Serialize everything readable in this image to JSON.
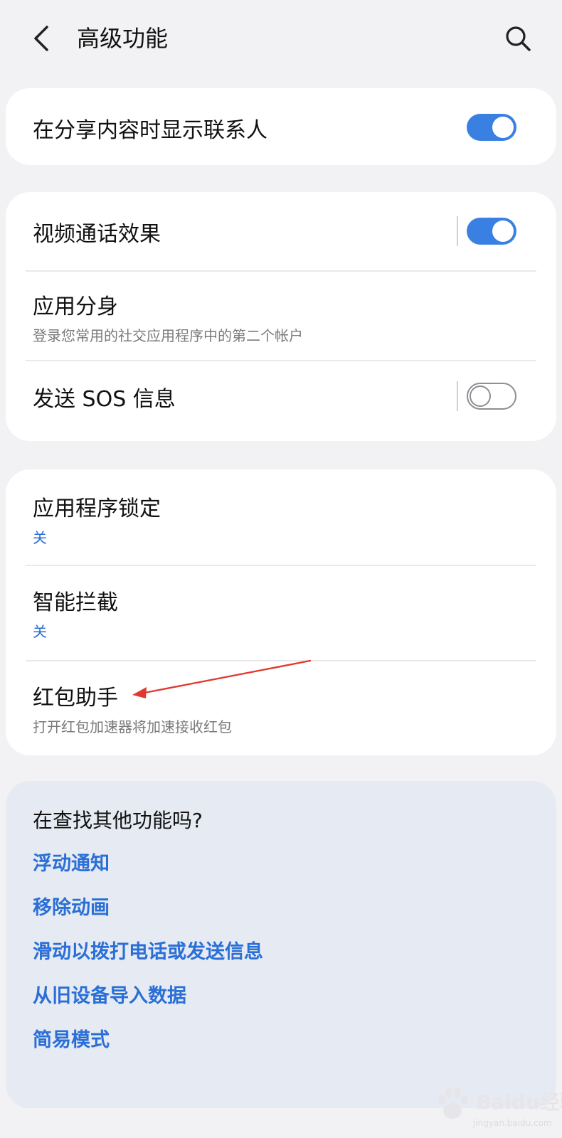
{
  "header": {
    "title": "高级功能",
    "back_icon": "chevron-left-icon",
    "search_icon": "search-icon"
  },
  "groups": [
    {
      "items": [
        {
          "title": "在分享内容时显示联系人",
          "toggle": "on"
        }
      ]
    },
    {
      "items": [
        {
          "title": "视频通话效果",
          "toggle": "on"
        },
        {
          "title": "应用分身",
          "subtitle": "登录您常用的社交应用程序中的第二个帐户"
        },
        {
          "title": "发送 SOS 信息",
          "toggle": "off"
        }
      ]
    },
    {
      "items": [
        {
          "title": "应用程序锁定",
          "status": "关"
        },
        {
          "title": "智能拦截",
          "status": "关"
        },
        {
          "title": "红包助手",
          "subtitle": "打开红包加速器将加速接收红包"
        }
      ]
    }
  ],
  "more": {
    "title": "在查找其他功能吗?",
    "links": [
      "浮动通知",
      "移除动画",
      "滑动以拨打电话或发送信息",
      "从旧设备导入数据",
      "简易模式"
    ]
  },
  "watermark": {
    "text": "Baidu经验",
    "url": "jingyan.baidu.com"
  },
  "colors": {
    "accent": "#3a80e3",
    "link": "#2a6fd6",
    "annotation_arrow": "#e03a2f"
  }
}
